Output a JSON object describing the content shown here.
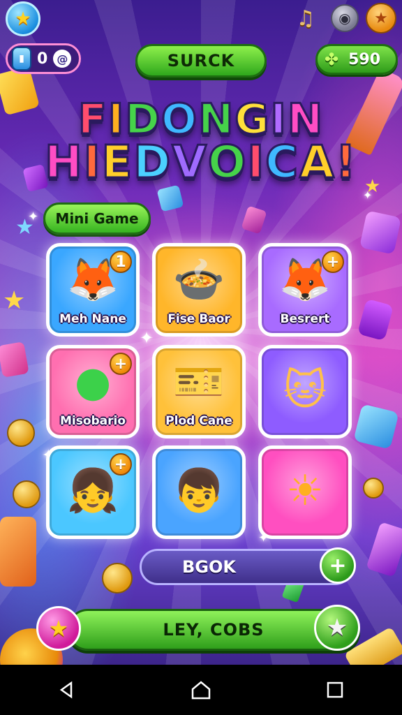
{
  "top_bar": {
    "gem_count": "0",
    "title": "SURCK",
    "score": "590"
  },
  "headline": {
    "line1": [
      "F",
      "I",
      "D",
      "O",
      "N",
      "G",
      "I",
      "N"
    ],
    "line2": [
      "H",
      "I",
      "E",
      "D",
      "V",
      "O",
      "I",
      "C",
      "A",
      "!"
    ],
    "line1_colors": [
      "#ff4d6d",
      "#ffb020",
      "#46d34a",
      "#3fb8ff",
      "#46d34a",
      "#ffe03a",
      "#b06bff",
      "#ff4dc4"
    ],
    "line2_colors": [
      "#ff4dc4",
      "#ff6a3d",
      "#ffcf2a",
      "#4bd0ff",
      "#9f6bff",
      "#46d34a",
      "#ff4d6d",
      "#3fb8ff",
      "#ffcf2a",
      "#ff6a3d"
    ]
  },
  "section_label": "Mini Game",
  "tiles": [
    {
      "label": "Meh Nane",
      "badge": "1",
      "bg": "#3aa7ff",
      "art": "boy-fox"
    },
    {
      "label": "Fise Baor",
      "badge": "",
      "bg": "#ffb62a",
      "art": "pot"
    },
    {
      "label": "Besrert",
      "badge": "+",
      "bg": "#a86bff",
      "art": "boy-fox-2"
    },
    {
      "label": "Misobario",
      "badge": "+",
      "bg": "#ff6fb0",
      "art": "green-blob"
    },
    {
      "label": "Plod Cane",
      "badge": "",
      "bg": "#ffc13a",
      "art": "ticket"
    },
    {
      "label": "",
      "badge": "",
      "bg": "#8e5cff",
      "art": "cat"
    },
    {
      "label": "",
      "badge": "+",
      "bg": "#4bc7ff",
      "art": "blonde-girl"
    },
    {
      "label": "",
      "badge": "",
      "bg": "#4aa4ff",
      "art": "boy"
    },
    {
      "label": "",
      "badge": "",
      "bg": "#ff4fc0",
      "art": "sun"
    }
  ],
  "book_bar": {
    "label": "BGOK",
    "plus": "+"
  },
  "play_bar": {
    "label": "LEY, COBS"
  },
  "colors": {
    "green": "#35b320",
    "purple_bg": "#6b2bb8"
  }
}
